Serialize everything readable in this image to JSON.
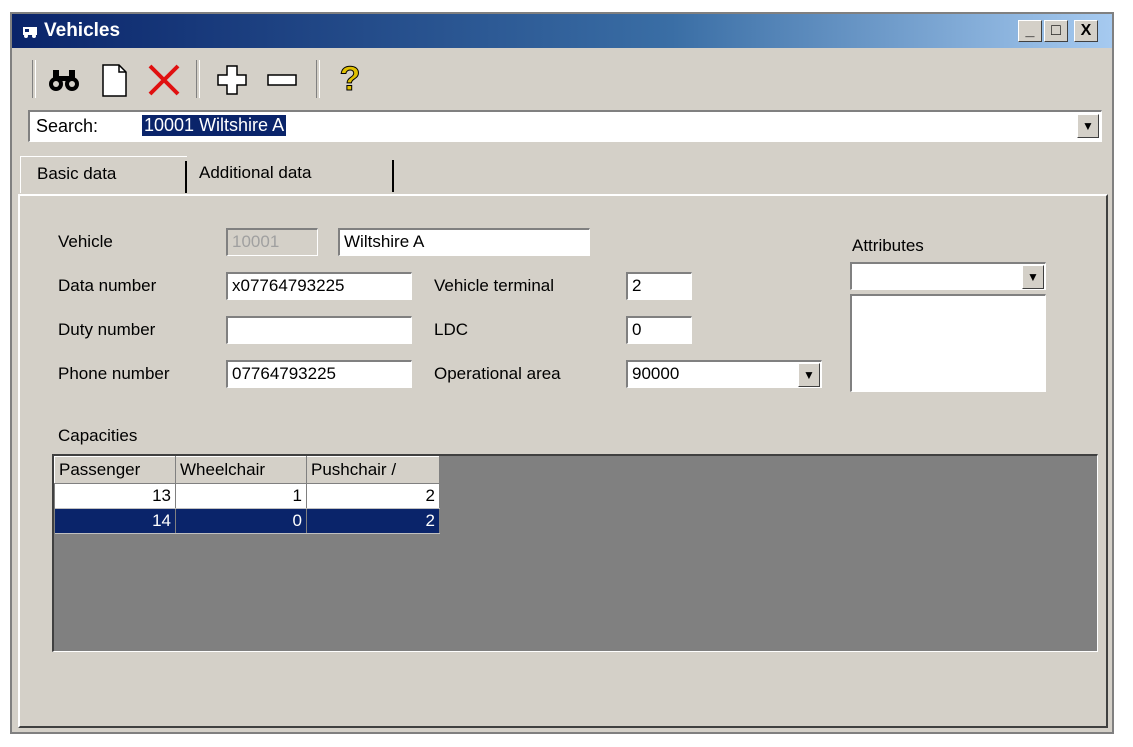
{
  "window": {
    "title": "Vehicles",
    "min_label": "_",
    "max_label": "□",
    "close_label": "X"
  },
  "toolbar": {
    "help_label": "?"
  },
  "search": {
    "label": "Search:",
    "value": "10001  Wiltshire A"
  },
  "tabs": [
    {
      "label": "Basic data"
    },
    {
      "label": "Additional data"
    }
  ],
  "form": {
    "vehicle": {
      "label": "Vehicle",
      "id": "10001",
      "name": "Wiltshire A"
    },
    "data_number": {
      "label": "Data number",
      "value": "x07764793225"
    },
    "duty_number": {
      "label": "Duty number",
      "value": ""
    },
    "phone_number": {
      "label": "Phone number",
      "value": "07764793225"
    },
    "vehicle_terminal": {
      "label": "Vehicle terminal",
      "value": "2"
    },
    "ldc": {
      "label": "LDC",
      "value": "0"
    },
    "operational_area": {
      "label": "Operational area",
      "value": "90000"
    },
    "attributes": {
      "label": "Attributes",
      "value": ""
    }
  },
  "capacities": {
    "label": "Capacities",
    "columns": [
      "Passenger",
      "Wheelchair",
      "Pushchair /"
    ],
    "rows": [
      {
        "cells": [
          "13",
          "1",
          "2"
        ]
      },
      {
        "cells": [
          "14",
          "0",
          "2"
        ]
      }
    ],
    "selected_row": 1
  },
  "colors": {
    "title_bar": "#0a246a",
    "selection": "#0a246a",
    "face": "#d4d0c8"
  }
}
